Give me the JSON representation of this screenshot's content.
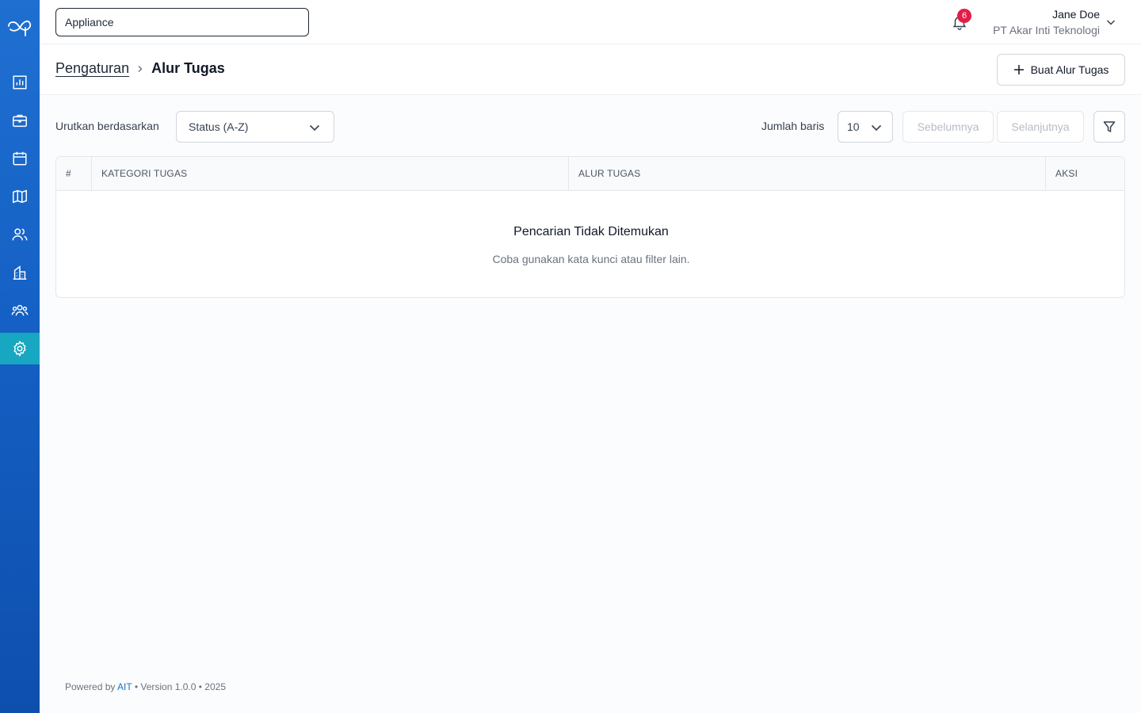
{
  "sidebar": {
    "logo_icon": "infinity-logo-icon",
    "items": [
      {
        "name": "dashboard",
        "icon": "bar-chart-icon",
        "active": false
      },
      {
        "name": "jobs",
        "icon": "briefcase-icon",
        "active": false
      },
      {
        "name": "calendar",
        "icon": "calendar-icon",
        "active": false
      },
      {
        "name": "map",
        "icon": "map-icon",
        "active": false
      },
      {
        "name": "users",
        "icon": "users-icon",
        "active": false
      },
      {
        "name": "buildings",
        "icon": "building-icon",
        "active": false
      },
      {
        "name": "teams",
        "icon": "team-icon",
        "active": false
      },
      {
        "name": "settings",
        "icon": "gear-icon",
        "active": true
      }
    ],
    "colors": {
      "background": "#1560c4",
      "active": "#17a7c0"
    }
  },
  "header": {
    "search": {
      "value": "Appliance",
      "placeholder": ""
    },
    "notifications": {
      "count": "6"
    },
    "user": {
      "name": "Jane Doe",
      "company": "PT Akar Inti Teknologi"
    }
  },
  "page": {
    "breadcrumb": {
      "parent": "Pengaturan",
      "current": "Alur Tugas"
    },
    "create_button_label": "Buat Alur Tugas"
  },
  "toolbar": {
    "sort_label": "Urutkan berdasarkan",
    "sort_value": "Status (A-Z)",
    "rows_label": "Jumlah baris",
    "rows_value": "10",
    "prev_label": "Sebelumnya",
    "next_label": "Selanjutnya"
  },
  "table": {
    "columns": [
      "#",
      "KATEGORI TUGAS",
      "ALUR TUGAS",
      "AKSI"
    ],
    "empty_title": "Pencarian Tidak Ditemukan",
    "empty_subtitle": "Coba gunakan kata kunci atau filter lain."
  },
  "footer": {
    "prefix": "Powered by",
    "brand": "AIT",
    "suffix": "• Version 1.0.0 • 2025"
  }
}
